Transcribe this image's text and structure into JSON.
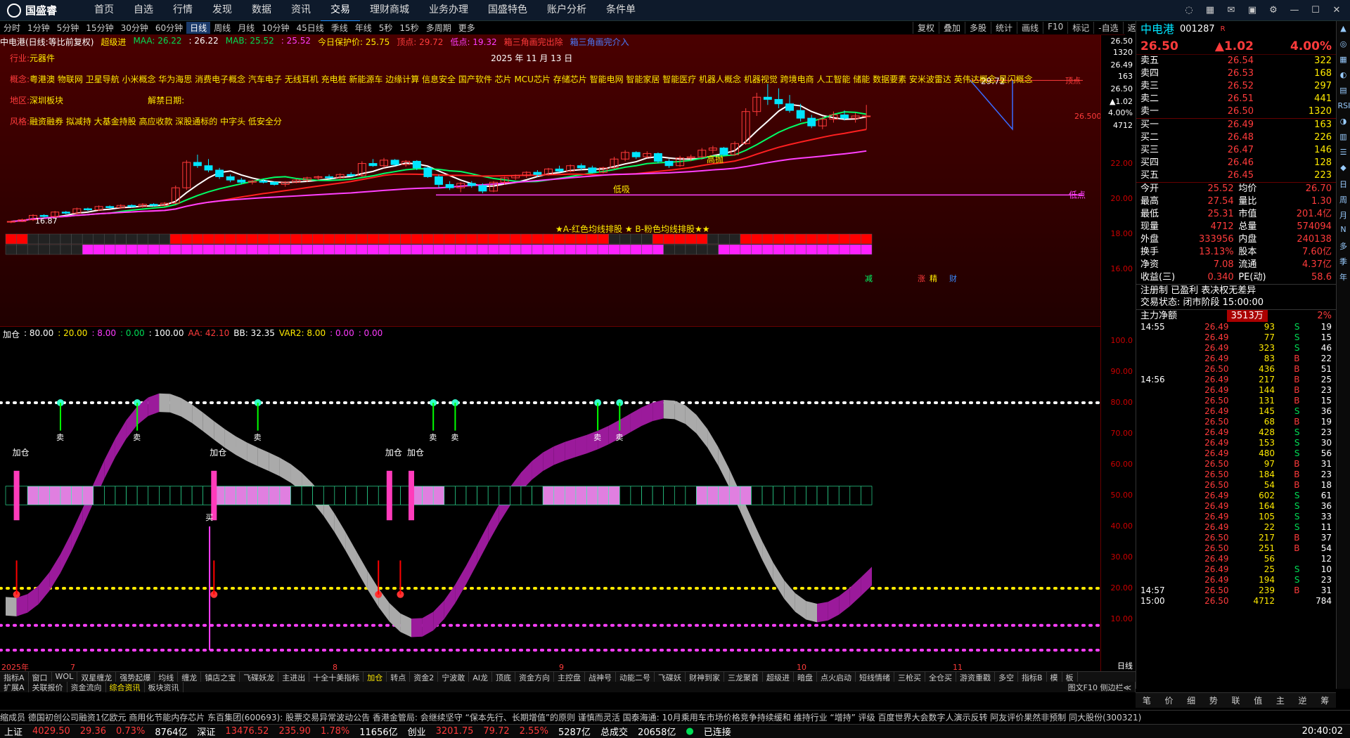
{
  "menu": {
    "logo": "国盛睿",
    "items": [
      "首页",
      "自选",
      "行情",
      "发现",
      "数据",
      "资讯",
      "交易",
      "理财商城",
      "业务办理",
      "国盛特色",
      "账户分析",
      "条件单"
    ],
    "active": "交易"
  },
  "periods": {
    "items": [
      "分时",
      "1分钟",
      "5分钟",
      "15分钟",
      "30分钟",
      "60分钟",
      "日线",
      "周线",
      "月线",
      "10分钟",
      "45日线",
      "季线",
      "年线",
      "5秒",
      "15秒",
      "多周期",
      "更多"
    ],
    "active": "日线"
  },
  "tools": [
    "复权",
    "叠加",
    "多股",
    "统计",
    "画线",
    "F10",
    "标记",
    "-自选",
    "返回"
  ],
  "header": {
    "name": "中电港(日线:等比前复权)",
    "indicator": "超级进",
    "maa": "MAA: 26.22",
    "maa2": ": 26.22",
    "mab": "MAB: 25.52",
    "mab2": ": 25.52",
    "avg": "今日保护价: 25.75",
    "top": "顶点: 29.72",
    "bottom": "低点: 19.32",
    "pattern": "箱三角画完出除",
    "pattern2": "箱三角画完介入"
  },
  "info": {
    "industry_label": "行业:",
    "industry": "元器件",
    "concept_label": "概念:",
    "concepts": "粤港澳 物联网 卫星导航 小米概念 华为海思 消费电子概念 汽车电子 无线耳机 充电桩 新能源车 边缘计算 信息安全 国产软件 芯片 MCU芯片 存储芯片 智能电网 智能家居 智能医疗 机器人概念 机器视觉 跨境电商 人工智能 储能 数据要素 安米波雷达 英伟达概念 星闪概念",
    "region_label": "地区:",
    "region": "深圳板块",
    "unlock_label": "解禁日期:",
    "style_label": "风格:",
    "style": "融资融券 拟减持 大基金持股 高应收款 深股通标的 中字头 低安全分",
    "date": "2025 年 11 月 13 日"
  },
  "chart_annot": {
    "high": "29.72",
    "low_label": "低点",
    "top_label": "顶点",
    "price_label": "26.500",
    "low_price": "16.87",
    "dijia": "低吸",
    "gaopao": "高抛",
    "bar_caption": "★A-红色均线排股 ★ B-粉色均线排股★★",
    "tags": [
      "减",
      "涨",
      "精",
      "财"
    ]
  },
  "main_axis": [
    "26.50",
    "1320",
    "26.49",
    "163",
    "26.50",
    "▲1.02",
    "4.00%",
    "4712",
    "22.00",
    "20.00",
    "18.00",
    "16.00"
  ],
  "sub_header": {
    "name": "加仓",
    "v1": ": 80.00",
    "v2": ": 20.00",
    "v3": ": 8.00",
    "v4": ": 0.00",
    "v5": ": 100.00",
    "aa": "AA: 42.10",
    "bb": "BB: 32.35",
    "var": "VAR2: 8.00",
    "v6": ": 0.00",
    "v7": ": 0.00"
  },
  "sub_axis": [
    "100.0",
    "90.00",
    "80.00",
    "70.00",
    "60.00",
    "50.00",
    "40.00",
    "30.00",
    "20.00",
    "10.00"
  ],
  "sub_labels": {
    "add": "加仓",
    "sell": "卖",
    "buy": "买"
  },
  "x_axis": {
    "labels": [
      "2025年",
      "7",
      "8",
      "9",
      "10",
      "11"
    ],
    "period": "日线"
  },
  "bottom_tabs": [
    "指标A",
    "窗口",
    "WOL",
    "双星缠龙",
    "强势起爆",
    "均线",
    "缠龙",
    "镇店之宝",
    "飞碟妖龙",
    "主进出",
    "十全十美指标",
    "加仓",
    "转点",
    "资金2",
    "宁波敢",
    "AI龙",
    "顶底",
    "资金方向",
    "主控盘",
    "战神号",
    "动能二号",
    "飞碟妖",
    "财神到家",
    "三龙聚首",
    "超级进",
    "暗盘",
    "点火启动",
    "短线情绪",
    "三枪买",
    "全仓买",
    "游资重戳",
    "多空",
    "指标B",
    "模",
    "板"
  ],
  "bottom_tabs_active": "加仓",
  "sub_tabs": [
    "扩展A",
    "关联报价",
    "资金流向",
    "综合资讯",
    "板块资讯"
  ],
  "sub_tabs_active": "综合资讯",
  "sub_tabs_right": "图文F10 侧边栏≪",
  "quote": {
    "name": "中电港",
    "code": "001287",
    "flag": "R",
    "price": "26.50",
    "change": "▲1.02",
    "pct": "4.00%",
    "asks": [
      [
        "卖五",
        "26.54",
        "322"
      ],
      [
        "卖四",
        "26.53",
        "168"
      ],
      [
        "卖三",
        "26.52",
        "297"
      ],
      [
        "卖二",
        "26.51",
        "441"
      ],
      [
        "卖一",
        "26.50",
        "1320"
      ]
    ],
    "bids": [
      [
        "买一",
        "26.49",
        "163"
      ],
      [
        "买二",
        "26.48",
        "226"
      ],
      [
        "买三",
        "26.47",
        "146"
      ],
      [
        "买四",
        "26.46",
        "128"
      ],
      [
        "买五",
        "26.45",
        "223"
      ]
    ],
    "stats": [
      [
        "今开",
        "25.52",
        "均价",
        "26.70"
      ],
      [
        "最高",
        "27.54",
        "量比",
        "1.30"
      ],
      [
        "最低",
        "25.31",
        "市值",
        "201.4亿"
      ],
      [
        "现量",
        "4712",
        "总量",
        "574094"
      ],
      [
        "外盘",
        "333956",
        "内盘",
        "240138"
      ],
      [
        "换手",
        "13.13%",
        "股本",
        "7.60亿"
      ],
      [
        "净资",
        "7.08",
        "流通",
        "4.37亿"
      ],
      [
        "收益(三)",
        "0.340",
        "PE(动)",
        "58.6"
      ]
    ],
    "reg": "注册制 已盈利 表决权无差异",
    "trade_state": "交易状态: 闭市阶段 15:00:00",
    "flow_label": "主力净额",
    "flow": "3513万",
    "flow_pct": "2%"
  },
  "ticks": [
    [
      "14:55",
      "26.49",
      "93",
      "S",
      "19"
    ],
    [
      "",
      "26.49",
      "77",
      "S",
      "15"
    ],
    [
      "",
      "26.49",
      "323",
      "S",
      "46"
    ],
    [
      "",
      "26.49",
      "83",
      "B",
      "22"
    ],
    [
      "",
      "26.50",
      "436",
      "B",
      "51"
    ],
    [
      "14:56",
      "26.49",
      "217",
      "B",
      "25"
    ],
    [
      "",
      "26.49",
      "144",
      "B",
      "23"
    ],
    [
      "",
      "26.50",
      "131",
      "B",
      "15"
    ],
    [
      "",
      "26.49",
      "145",
      "S",
      "36"
    ],
    [
      "",
      "26.50",
      "68",
      "B",
      "19"
    ],
    [
      "",
      "26.49",
      "428",
      "S",
      "23"
    ],
    [
      "",
      "26.49",
      "153",
      "S",
      "30"
    ],
    [
      "",
      "26.49",
      "480",
      "S",
      "56"
    ],
    [
      "",
      "26.50",
      "97",
      "B",
      "31"
    ],
    [
      "",
      "26.50",
      "184",
      "B",
      "23"
    ],
    [
      "",
      "26.50",
      "54",
      "B",
      "18"
    ],
    [
      "",
      "26.49",
      "602",
      "S",
      "61"
    ],
    [
      "",
      "26.49",
      "164",
      "S",
      "36"
    ],
    [
      "",
      "26.49",
      "105",
      "S",
      "33"
    ],
    [
      "",
      "26.49",
      "22",
      "S",
      "11"
    ],
    [
      "",
      "26.50",
      "217",
      "B",
      "37"
    ],
    [
      "",
      "26.50",
      "251",
      "B",
      "54"
    ],
    [
      "",
      "26.49",
      "56",
      "",
      "12"
    ],
    [
      "",
      "26.49",
      "25",
      "S",
      "10"
    ],
    [
      "",
      "26.49",
      "194",
      "S",
      "23"
    ],
    [
      "14:57",
      "26.50",
      "239",
      "B",
      "31"
    ],
    [
      "15:00",
      "26.50",
      "4712",
      "",
      "784"
    ]
  ],
  "panel_tabs": [
    "笔",
    "价",
    "细",
    "势",
    "联",
    "值",
    "主",
    "逆",
    "筹"
  ],
  "sidebar": [
    "▲",
    "◎",
    "▦",
    "◐",
    "▤",
    "RSI",
    "◑",
    "▥",
    "☰",
    "◆",
    "日",
    "周",
    "月",
    "N",
    "多",
    "季",
    "年"
  ],
  "news": "缩成员    德国初创公司融资1亿欧元 商用化节能内存芯片        东百集团(600693): 股票交易异常波动公告        香港金管局: 会继续坚守 “保本先行、长期增值”的原则 谨慎而灵活        国泰海通: 10月乘用车市场价格竞争持续缓和 维持行业 “增持” 评级        百度世界大会数字人演示反转 阿友评价果然非预制        同大股份(300321)",
  "status": {
    "sh_label": "上证",
    "sh": "4029.50",
    "sh_chg": "29.36",
    "sh_pct": "0.73%",
    "sh_amt": "8764亿",
    "sz_label": "深证",
    "sz": "13476.52",
    "sz_chg": "235.90",
    "sz_pct": "1.78%",
    "sz_amt": "11656亿",
    "cy_label": "创业",
    "cy": "3201.75",
    "cy_chg": "79.72",
    "cy_pct": "2.55%",
    "cy_amt": "5287亿",
    "total_label": "总成交",
    "total": "20658亿",
    "conn": "已连接",
    "time": "20:40:02"
  },
  "colors": {
    "up": "#ff3b3b",
    "down": "#00e5ff",
    "ma1": "#ff2020",
    "ma2": "#ff40ff",
    "ma3": "#ffffff",
    "ma4": "#00ff66",
    "band1": "#9b1a9b",
    "band2": "#aaaaaa"
  },
  "chart_data": {
    "type": "candlestick",
    "x_labels": [
      "2025年",
      "7",
      "8",
      "9",
      "10",
      "11"
    ],
    "ylim": [
      16,
      30
    ],
    "ohlc": [
      [
        16.9,
        17.0,
        16.8,
        16.95
      ],
      [
        16.95,
        17.2,
        16.9,
        17.1
      ],
      [
        17.1,
        17.6,
        17.0,
        17.5
      ],
      [
        17.5,
        17.6,
        17.3,
        17.4
      ],
      [
        17.4,
        17.9,
        17.3,
        17.8
      ],
      [
        17.8,
        17.9,
        17.6,
        17.7
      ],
      [
        17.7,
        18.2,
        17.6,
        18.1
      ],
      [
        18.1,
        18.2,
        17.9,
        18.0
      ],
      [
        18.0,
        18.4,
        17.9,
        18.3
      ],
      [
        18.3,
        18.4,
        18.1,
        18.2
      ],
      [
        18.2,
        18.5,
        18.1,
        18.4
      ],
      [
        18.4,
        18.5,
        18.2,
        18.3
      ],
      [
        18.3,
        18.6,
        18.2,
        18.5
      ],
      [
        18.5,
        18.6,
        18.3,
        18.4
      ],
      [
        18.4,
        18.7,
        18.3,
        18.6
      ],
      [
        18.6,
        20.2,
        18.5,
        20.0
      ],
      [
        20.0,
        22.5,
        19.8,
        22.3
      ],
      [
        22.3,
        23.0,
        21.8,
        22.0
      ],
      [
        22.0,
        22.6,
        21.4,
        21.6
      ],
      [
        21.6,
        21.8,
        20.8,
        21.0
      ],
      [
        21.0,
        21.2,
        20.5,
        20.7
      ],
      [
        20.7,
        20.9,
        20.3,
        20.5
      ],
      [
        20.5,
        20.7,
        20.3,
        20.6
      ],
      [
        20.6,
        20.8,
        20.4,
        20.5
      ],
      [
        20.5,
        20.6,
        20.2,
        20.3
      ],
      [
        20.3,
        20.6,
        20.1,
        20.5
      ],
      [
        20.5,
        20.8,
        20.4,
        20.7
      ],
      [
        20.7,
        21.0,
        20.5,
        20.9
      ],
      [
        20.9,
        21.1,
        20.7,
        21.0
      ],
      [
        21.0,
        21.2,
        20.8,
        20.9
      ],
      [
        20.9,
        21.3,
        20.8,
        21.2
      ],
      [
        21.2,
        21.4,
        21.0,
        21.1
      ],
      [
        21.1,
        22.4,
        21.0,
        22.2
      ],
      [
        22.2,
        22.6,
        21.9,
        22.0
      ],
      [
        22.0,
        22.7,
        21.8,
        22.5
      ],
      [
        22.5,
        22.6,
        22.0,
        22.1
      ],
      [
        22.1,
        22.5,
        21.9,
        22.4
      ],
      [
        22.4,
        22.5,
        21.6,
        21.8
      ],
      [
        21.8,
        21.9,
        20.9,
        21.0
      ],
      [
        21.0,
        21.2,
        20.0,
        20.3
      ],
      [
        20.3,
        20.6,
        19.8,
        20.0
      ],
      [
        20.0,
        20.5,
        19.6,
        20.4
      ],
      [
        20.4,
        20.6,
        20.0,
        20.2
      ],
      [
        20.2,
        20.4,
        19.5,
        19.7
      ],
      [
        19.7,
        20.6,
        19.6,
        20.5
      ],
      [
        20.5,
        21.0,
        20.3,
        20.9
      ],
      [
        20.9,
        21.2,
        20.7,
        21.1
      ],
      [
        21.1,
        21.5,
        20.9,
        21.4
      ],
      [
        21.4,
        21.6,
        21.0,
        21.2
      ],
      [
        21.2,
        21.8,
        21.1,
        21.7
      ],
      [
        21.7,
        22.0,
        21.4,
        21.5
      ],
      [
        21.5,
        22.1,
        21.4,
        22.0
      ],
      [
        22.0,
        22.2,
        21.6,
        21.8
      ],
      [
        21.8,
        22.0,
        21.3,
        21.4
      ],
      [
        21.4,
        21.9,
        21.3,
        21.8
      ],
      [
        21.8,
        22.8,
        21.7,
        22.6
      ],
      [
        22.6,
        23.4,
        22.4,
        23.2
      ],
      [
        23.2,
        23.3,
        22.6,
        22.8
      ],
      [
        22.8,
        23.3,
        22.7,
        23.1
      ],
      [
        23.1,
        23.2,
        22.2,
        22.4
      ],
      [
        22.4,
        22.6,
        21.8,
        22.0
      ],
      [
        22.0,
        22.9,
        21.9,
        22.7
      ],
      [
        22.7,
        23.0,
        22.4,
        22.8
      ],
      [
        22.8,
        23.6,
        22.7,
        23.4
      ],
      [
        23.4,
        23.8,
        23.1,
        23.6
      ],
      [
        23.6,
        23.7,
        22.9,
        23.0
      ],
      [
        23.0,
        24.2,
        22.9,
        24.0
      ],
      [
        24.0,
        27.2,
        23.9,
        26.9
      ],
      [
        26.9,
        28.6,
        26.5,
        28.2
      ],
      [
        28.2,
        29.4,
        27.5,
        28.0
      ],
      [
        28.0,
        29.0,
        27.2,
        27.6
      ],
      [
        27.6,
        28.4,
        26.8,
        27.0
      ],
      [
        27.0,
        27.6,
        26.0,
        26.3
      ],
      [
        26.3,
        26.6,
        25.4,
        25.6
      ],
      [
        25.6,
        26.4,
        25.3,
        26.2
      ],
      [
        26.2,
        26.9,
        25.9,
        26.6
      ],
      [
        26.6,
        27.0,
        26.1,
        26.3
      ],
      [
        26.3,
        26.8,
        25.9,
        26.5
      ],
      [
        26.5,
        27.5,
        25.3,
        26.5
      ]
    ],
    "series": [
      {
        "name": "MAA",
        "values": [
          26.22
        ]
      },
      {
        "name": "MAB",
        "values": [
          25.52
        ]
      }
    ],
    "sub_series": {
      "name": "加仓",
      "ref_lines": [
        80,
        20,
        8,
        0
      ],
      "aa": 42.1,
      "bb": 32.35
    }
  }
}
